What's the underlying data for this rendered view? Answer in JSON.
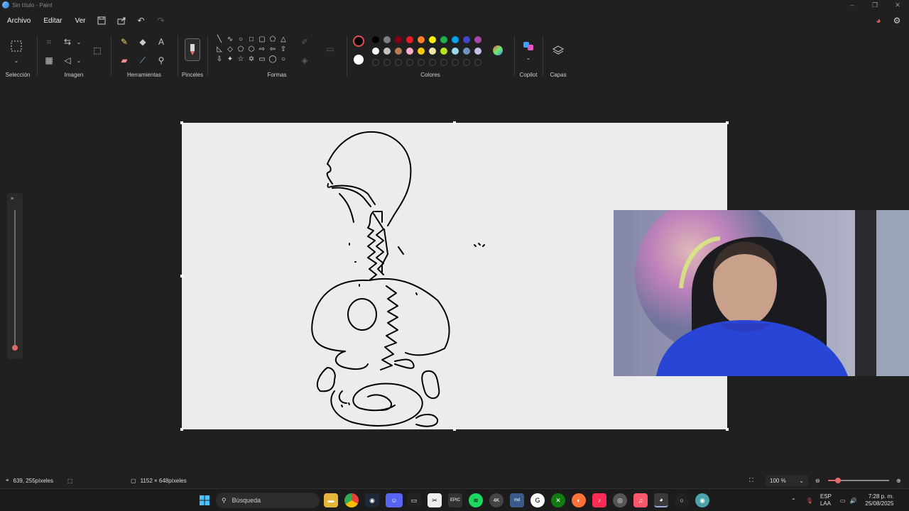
{
  "window": {
    "title": "Sin título - Paint"
  },
  "menu": {
    "items": [
      "Archivo",
      "Editar",
      "Ver"
    ]
  },
  "ribbon": {
    "groups": {
      "seleccion": "Selección",
      "imagen": "Imagen",
      "herramientas": "Herramientas",
      "pinceles": "Pinceles",
      "formas": "Formas",
      "colores": "Colores",
      "copilot": "Copilot",
      "capas": "Capas"
    },
    "colors": {
      "primary": "#000000",
      "secondary": "#ffffff",
      "row1": [
        "#000000",
        "#7f7f7f",
        "#880015",
        "#ed1c24",
        "#ff7f27",
        "#fff200",
        "#22b14c",
        "#00a2e8",
        "#3f48cc",
        "#a349a4"
      ],
      "row2": [
        "#ffffff",
        "#c3c3c3",
        "#b97a57",
        "#ffaec9",
        "#ffc90e",
        "#efe4b0",
        "#b5e61d",
        "#99d9ea",
        "#7092be",
        "#c8bfe7"
      ]
    }
  },
  "status": {
    "cursor_position": "639, 255píxeles",
    "canvas_size": "1152 × 648píxeles",
    "zoom": "100 %"
  },
  "taskbar": {
    "search_placeholder": "Búsqueda",
    "language": "ESP",
    "keyboard": "LAA",
    "time": "7:28 p. m.",
    "date": "25/08/2025"
  }
}
